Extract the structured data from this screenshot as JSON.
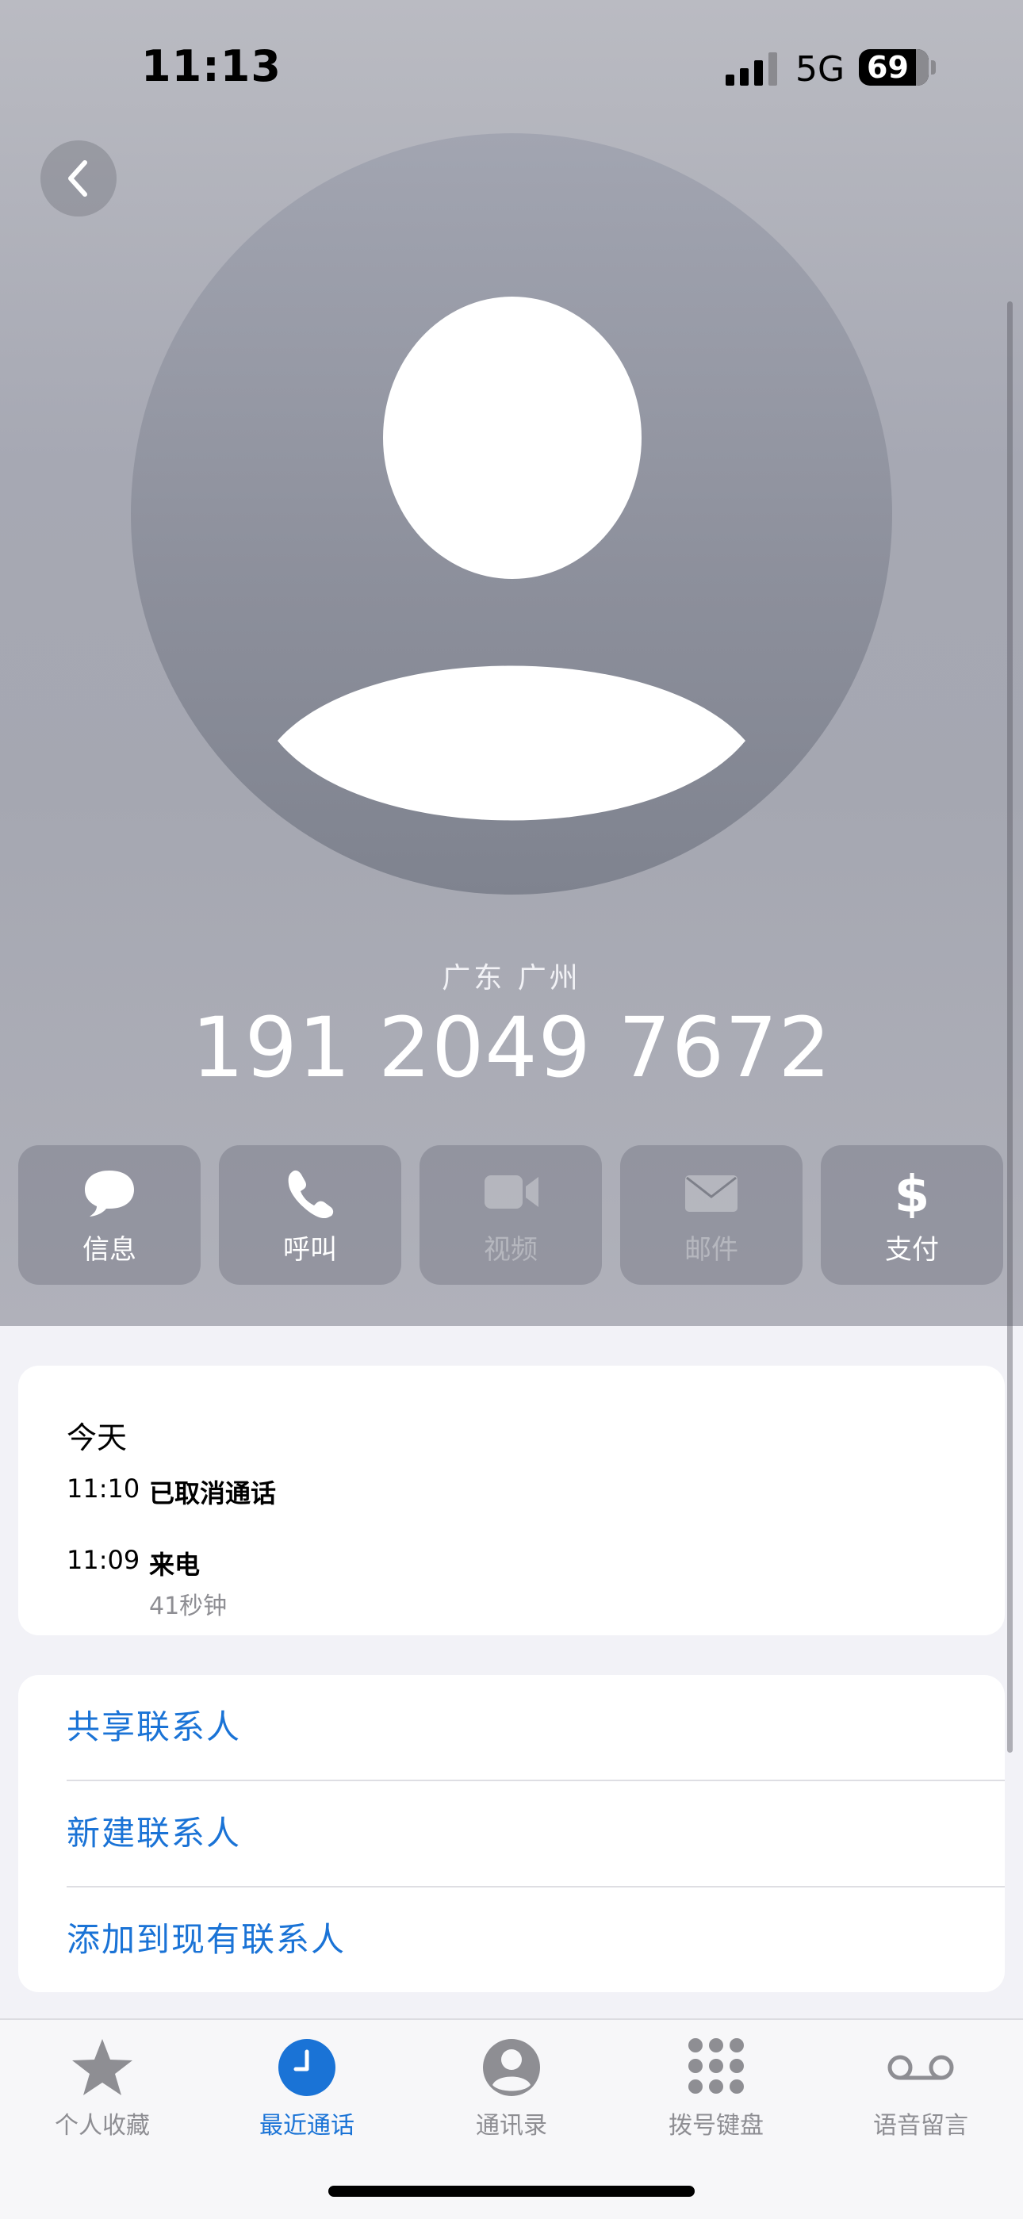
{
  "status_bar": {
    "time": "11:13",
    "network": "5G",
    "battery": "69"
  },
  "contact": {
    "location": "广东 广州",
    "phone_number": "191 2049 7672"
  },
  "actions": [
    {
      "label": "信息",
      "icon": "message-bubble-icon",
      "enabled": true
    },
    {
      "label": "呼叫",
      "icon": "phone-icon",
      "enabled": true
    },
    {
      "label": "视频",
      "icon": "video-camera-icon",
      "enabled": false
    },
    {
      "label": "邮件",
      "icon": "envelope-icon",
      "enabled": false
    },
    {
      "label": "支付",
      "icon": "dollar-icon",
      "enabled": true
    }
  ],
  "history": {
    "date": "今天",
    "calls": [
      {
        "time": "11:10",
        "type": "已取消通话",
        "duration": ""
      },
      {
        "time": "11:09",
        "type": "来电",
        "duration": "41秒钟"
      }
    ]
  },
  "options": [
    {
      "label": "共享联系人"
    },
    {
      "label": "新建联系人"
    },
    {
      "label": "添加到现有联系人"
    }
  ],
  "tabs": [
    {
      "label": "个人收藏",
      "icon": "star-icon",
      "active": false
    },
    {
      "label": "最近通话",
      "icon": "clock-icon",
      "active": true
    },
    {
      "label": "通讯录",
      "icon": "person-circle-icon",
      "active": false
    },
    {
      "label": "拨号键盘",
      "icon": "keypad-icon",
      "active": false
    },
    {
      "label": "语音留言",
      "icon": "voicemail-icon",
      "active": false
    }
  ],
  "colors": {
    "accent": "#1a73d6",
    "inactive_tab": "#8e8e93"
  }
}
